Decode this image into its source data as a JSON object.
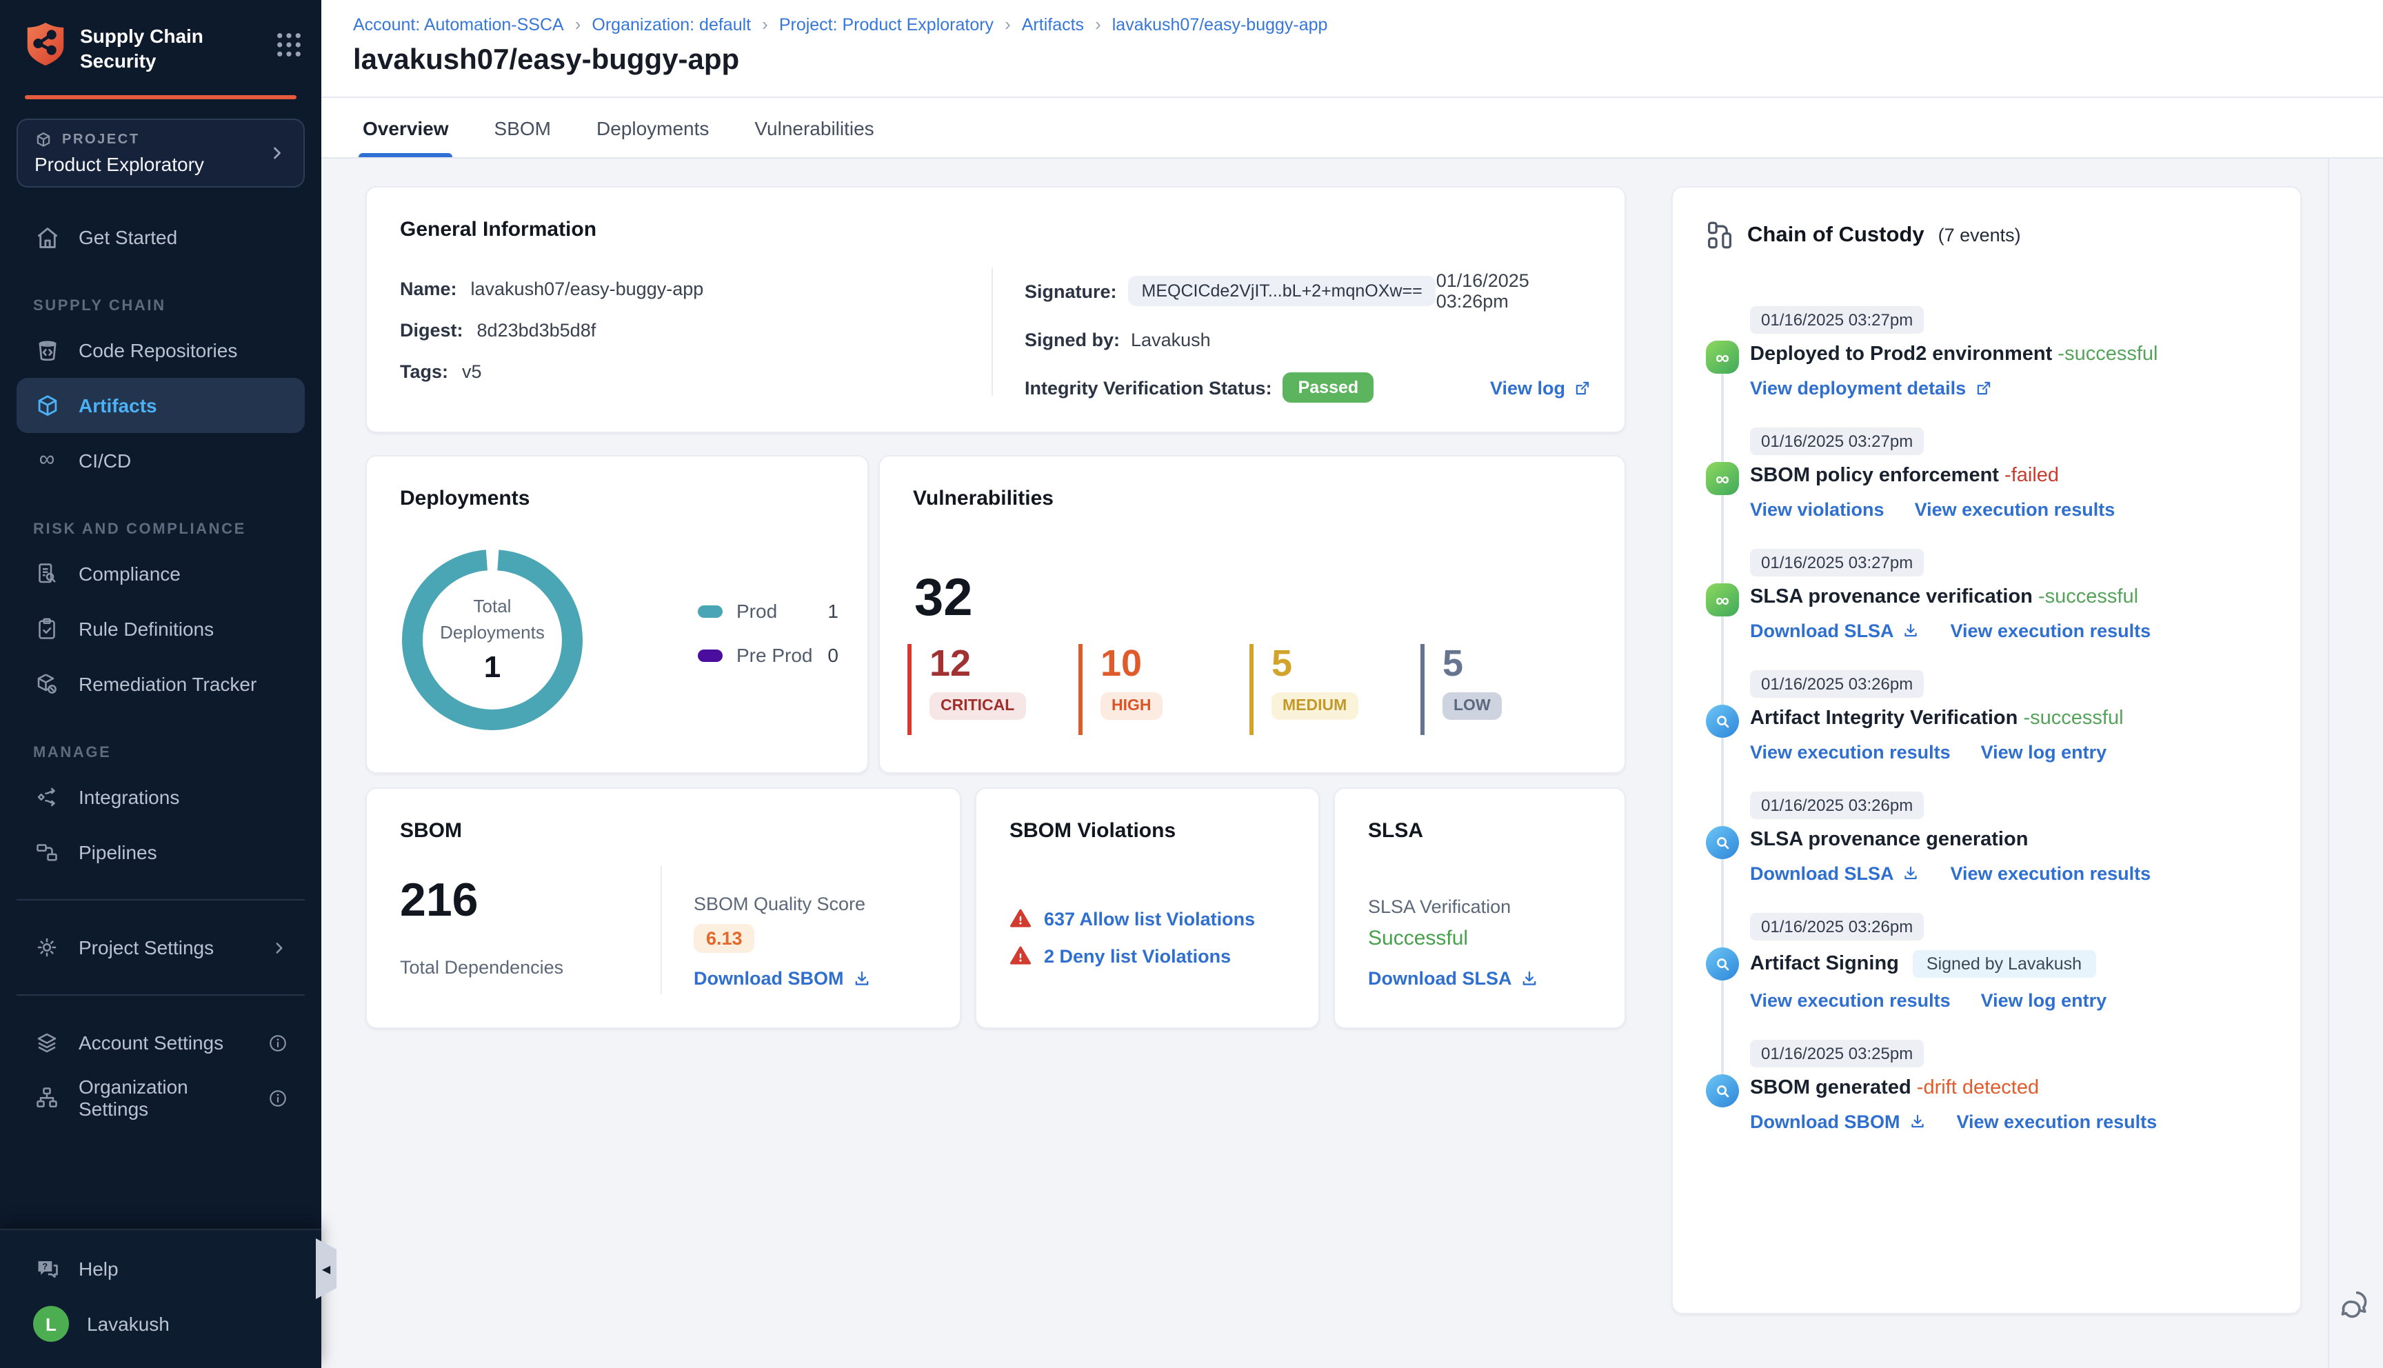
{
  "colors": {
    "sidebar_bg": "#0d1a2c",
    "accent_orange": "#e65a3d",
    "active_blue": "#4cb1f5",
    "link_blue": "#2e6fd0",
    "breadcrumb_blue": "#3677d9",
    "passed_green": "#5cb55e",
    "success_green": "#55a35a",
    "failed_red": "#c93d30",
    "drift_orange": "#e35b2b",
    "donut_teal": "#4AA5B4",
    "preprod_purple": "#4A0D9E",
    "critical": "#d23b30",
    "high": "#e05b2b",
    "medium": "#d2a32b",
    "low": "#67748f"
  },
  "app": {
    "title_line1": "Supply Chain",
    "title_line2": "Security"
  },
  "project": {
    "label": "PROJECT",
    "name": "Product Exploratory"
  },
  "sidebar": {
    "get_started": "Get Started",
    "sections": [
      {
        "label": "SUPPLY CHAIN",
        "items": [
          "Code Repositories",
          "Artifacts",
          "CI/CD"
        ]
      },
      {
        "label": "RISK AND COMPLIANCE",
        "items": [
          "Compliance",
          "Rule Definitions",
          "Remediation Tracker"
        ]
      },
      {
        "label": "MANAGE",
        "items": [
          "Integrations",
          "Pipelines"
        ]
      }
    ],
    "project_settings": "Project Settings",
    "account_settings": "Account Settings",
    "organization_settings": "Organization Settings",
    "help": "Help",
    "user": "Lavakush",
    "user_initial": "L"
  },
  "breadcrumb": {
    "items": [
      "Account: Automation-SSCA",
      "Organization: default",
      "Project: Product Exploratory",
      "Artifacts",
      "lavakush07/easy-buggy-app"
    ]
  },
  "page": {
    "title": "lavakush07/easy-buggy-app"
  },
  "tabs": [
    "Overview",
    "SBOM",
    "Deployments",
    "Vulnerabilities"
  ],
  "general_info": {
    "title": "General Information",
    "name_label": "Name:",
    "name": "lavakush07/easy-buggy-app",
    "digest_label": "Digest:",
    "digest": "8d23bd3b5d8f",
    "tags_label": "Tags:",
    "tags": "v5",
    "signature_label": "Signature:",
    "signature": "MEQCICde2VjIT...bL+2+mqnOXw==",
    "signature_time": "01/16/2025 03:26pm",
    "signed_by_label": "Signed by:",
    "signed_by": "Lavakush",
    "integrity_label": "Integrity Verification Status:",
    "integrity_status": "Passed",
    "view_log": "View log"
  },
  "deployments": {
    "title": "Deployments",
    "center_line1": "Total",
    "center_line2": "Deployments",
    "total": "1",
    "legend": [
      {
        "label": "Prod",
        "count": "1",
        "color": "#4AA5B4"
      },
      {
        "label": "Pre Prod",
        "count": "0",
        "color": "#4A0D9E"
      }
    ]
  },
  "chart_data": {
    "type": "pie",
    "title": "Total Deployments",
    "categories": [
      "Prod",
      "Pre Prod"
    ],
    "values": [
      1,
      0
    ],
    "total": 1,
    "legend_position": "right"
  },
  "vulnerabilities": {
    "title": "Vulnerabilities",
    "total": "32",
    "severities": [
      {
        "count": "12",
        "label": "CRITICAL",
        "color": "#d23b30"
      },
      {
        "count": "10",
        "label": "HIGH",
        "color": "#e05b2b"
      },
      {
        "count": "5",
        "label": "MEDIUM",
        "color": "#d2a32b"
      },
      {
        "count": "5",
        "label": "LOW",
        "color": "#67748f"
      }
    ]
  },
  "sbom": {
    "title": "SBOM",
    "total": "216",
    "total_label": "Total Dependencies",
    "quality_label": "SBOM Quality Score",
    "quality_score": "6.13",
    "download": "Download SBOM"
  },
  "sbom_violations": {
    "title": "SBOM Violations",
    "allow": "637 Allow list Violations",
    "deny": "2 Deny list Violations"
  },
  "slsa": {
    "title": "SLSA",
    "verification_label": "SLSA Verification",
    "status": "Successful",
    "download": "Download SLSA"
  },
  "chain": {
    "title": "Chain of Custody",
    "events_count": "(7 events)",
    "events": [
      {
        "time": "01/16/2025 03:27pm",
        "title": "Deployed to Prod2 environment",
        "sep": " - ",
        "status": "successful",
        "links": [
          "View deployment details"
        ]
      },
      {
        "time": "01/16/2025 03:27pm",
        "title": "SBOM policy enforcement",
        "sep": " - ",
        "status": "failed",
        "links": [
          "View violations",
          "View execution results"
        ]
      },
      {
        "time": "01/16/2025 03:27pm",
        "title": "SLSA provenance verification",
        "sep": " - ",
        "status": "successful",
        "links": [
          "Download SLSA",
          "View execution results"
        ]
      },
      {
        "time": "01/16/2025 03:26pm",
        "title": "Artifact Integrity Verification",
        "sep": " - ",
        "status": "successful",
        "links": [
          "View execution results",
          "View log entry"
        ]
      },
      {
        "time": "01/16/2025 03:26pm",
        "title": "SLSA provenance generation",
        "links": [
          "Download SLSA",
          "View execution results"
        ]
      },
      {
        "time": "01/16/2025 03:26pm",
        "title": "Artifact Signing",
        "chip": "Signed by Lavakush",
        "links": [
          "View execution results",
          "View log entry"
        ]
      },
      {
        "time": "01/16/2025 03:25pm",
        "title": "SBOM generated",
        "sep": " - ",
        "status": "drift detected",
        "links": [
          "Download SBOM",
          "View execution results"
        ]
      }
    ]
  }
}
